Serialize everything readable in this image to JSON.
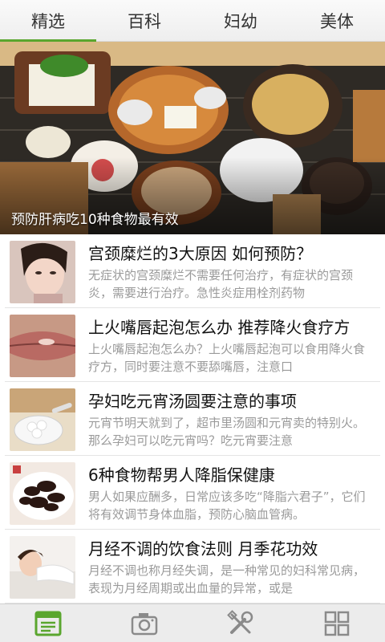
{
  "tabs": [
    {
      "label": "精选",
      "active": true
    },
    {
      "label": "百科",
      "active": false
    },
    {
      "label": "妇幼",
      "active": false
    },
    {
      "label": "美体",
      "active": false
    }
  ],
  "banner": {
    "caption": "预防肝病吃10种食物最有效"
  },
  "articles": [
    {
      "title": "宫颈糜烂的3大原因 如何预防？",
      "desc": "无症状的宫颈糜烂不需要任何治疗，有症状的宫颈炎，需要进行治疗。急性炎症用栓剂药物"
    },
    {
      "title": "上火嘴唇起泡怎么办 推荐降火食疗方",
      "desc": "上火嘴唇起泡怎么办？上火嘴唇起泡可以食用降火食疗方，同时要注意不要舔嘴唇，注意口"
    },
    {
      "title": "孕妇吃元宵汤圆要注意的事项",
      "desc": "元宵节明天就到了，超市里汤圆和元宵卖的特别火。那么孕妇可以吃元宵吗？吃元宵要注意"
    },
    {
      "title": "6种食物帮男人降脂保健康",
      "desc": "男人如果应酬多，日常应该多吃“降脂六君子”，它们将有效调节身体血脂，预防心脑血管病。"
    },
    {
      "title": "月经不调的饮食法则 月季花功效",
      "desc": "月经不调也称月经失调，是一种常见的妇科常见病，表现为月经周期或出血量的异常，或是"
    }
  ],
  "bottom_nav": [
    {
      "icon": "news-icon",
      "active": true
    },
    {
      "icon": "camera-icon",
      "active": false
    },
    {
      "icon": "tools-icon",
      "active": false
    },
    {
      "icon": "grid-icon",
      "active": false
    }
  ],
  "colors": {
    "accent": "#5aa62e",
    "inactive_icon": "#8a8a8a"
  }
}
